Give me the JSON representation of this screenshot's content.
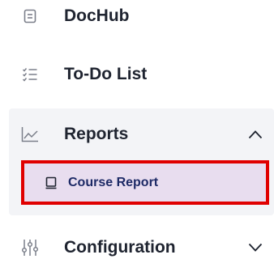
{
  "sidebar": {
    "items": [
      {
        "label": "DocHub",
        "icon": "document-icon"
      },
      {
        "label": "To-Do List",
        "icon": "checklist-icon"
      },
      {
        "label": "Reports",
        "icon": "line-chart-icon",
        "expanded": true,
        "children": [
          {
            "label": "Course Report",
            "icon": "book-icon",
            "selected": true
          }
        ]
      },
      {
        "label": "Configuration",
        "icon": "sliders-icon",
        "expanded": false
      }
    ]
  },
  "colors": {
    "text": "#1f2430",
    "group_background": "#f3f4f7",
    "selected_background": "#e8ddef",
    "selected_text": "#1d2a66",
    "highlight_border": "#e00000",
    "icon": "#7b7f8a"
  }
}
